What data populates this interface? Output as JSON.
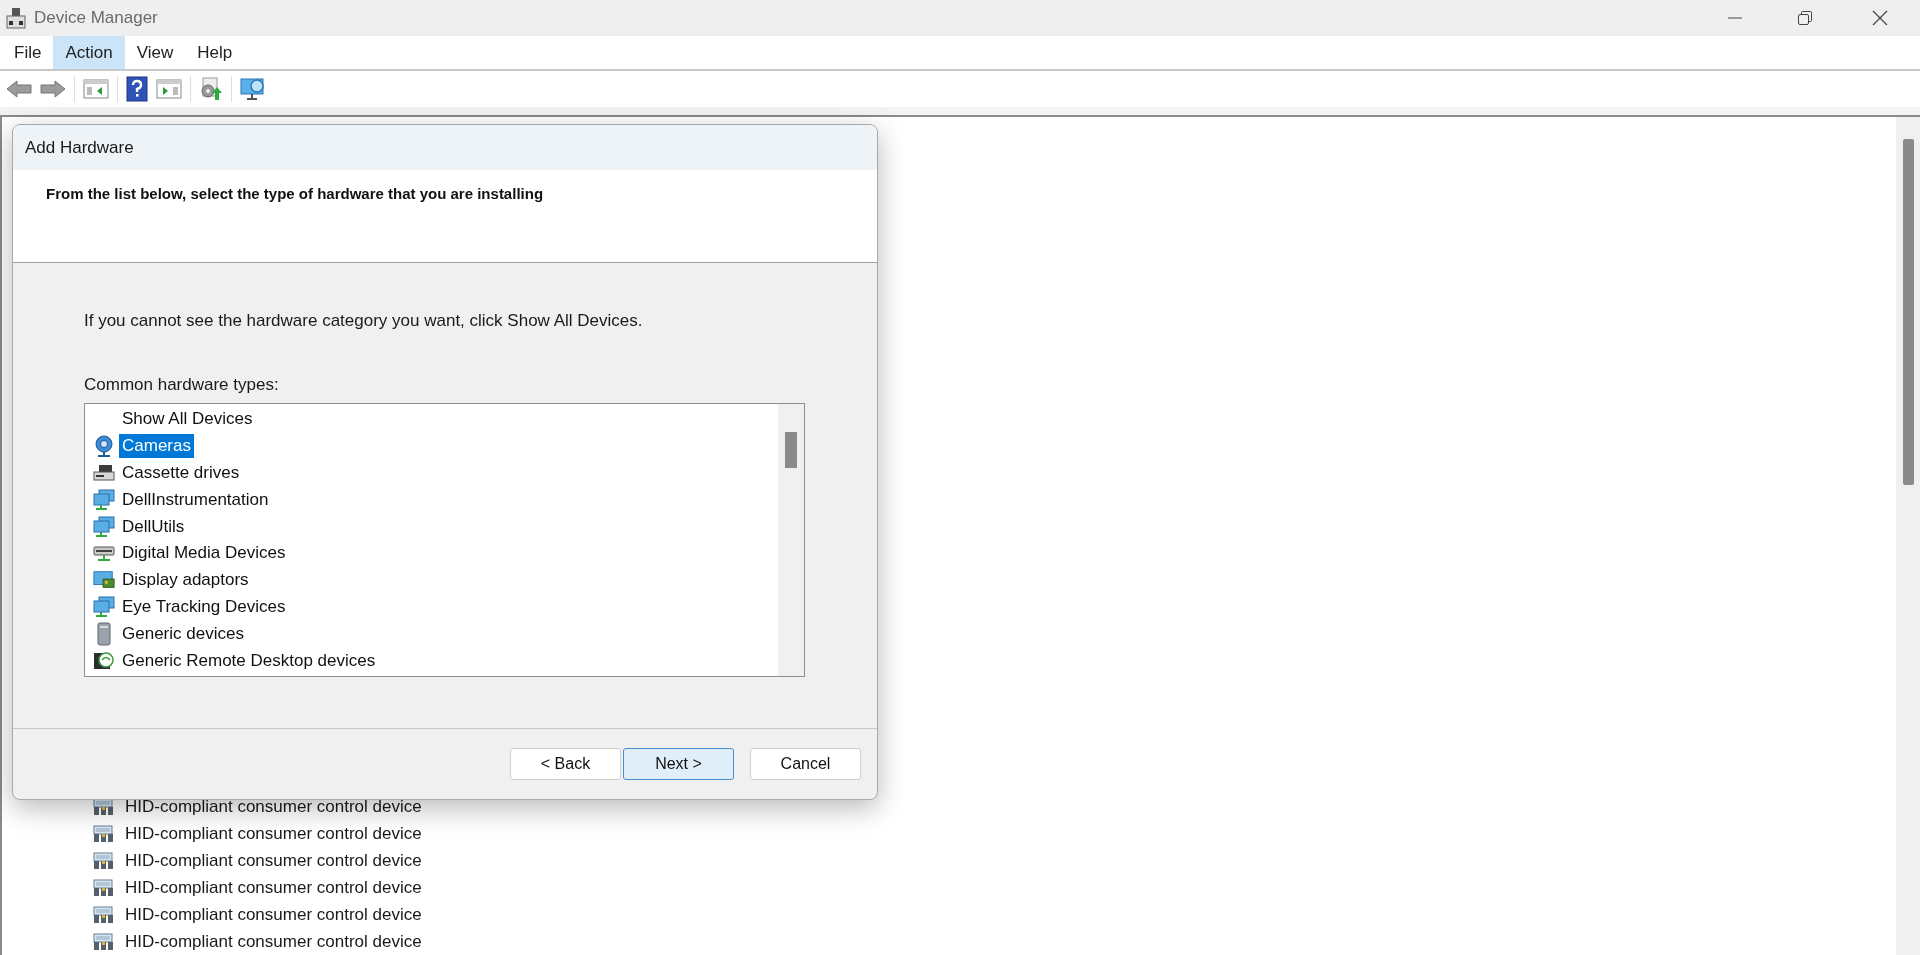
{
  "window": {
    "title": "Device Manager"
  },
  "menu": [
    {
      "label": "File",
      "selected": false
    },
    {
      "label": "Action",
      "selected": true
    },
    {
      "label": "View",
      "selected": false
    },
    {
      "label": "Help",
      "selected": false
    }
  ],
  "devices": [
    {
      "name": "HID-compliant consumer control device"
    },
    {
      "name": "HID-compliant consumer control device"
    },
    {
      "name": "HID-compliant consumer control device"
    },
    {
      "name": "HID-compliant consumer control device"
    },
    {
      "name": "HID-compliant consumer control device"
    },
    {
      "name": "HID-compliant consumer control device"
    }
  ],
  "dialog": {
    "title": "Add Hardware",
    "heading": "From the list below, select the type of hardware that you are installing",
    "hint": "If you cannot see the hardware category you want, click Show All Devices.",
    "list_label": "Common hardware types:",
    "hardware_types": [
      {
        "label": "Show All Devices",
        "kind": "plain",
        "selected": false
      },
      {
        "label": "Cameras",
        "kind": "camera",
        "selected": true
      },
      {
        "label": "Cassette drives",
        "kind": "cassette",
        "selected": false
      },
      {
        "label": "DellInstrumentation",
        "kind": "network",
        "selected": false
      },
      {
        "label": "DellUtils",
        "kind": "network",
        "selected": false
      },
      {
        "label": "Digital Media Devices",
        "kind": "media",
        "selected": false
      },
      {
        "label": "Display adaptors",
        "kind": "display",
        "selected": false
      },
      {
        "label": "Eye Tracking Devices",
        "kind": "network",
        "selected": false
      },
      {
        "label": "Generic devices",
        "kind": "generic",
        "selected": false
      },
      {
        "label": "Generic Remote Desktop devices",
        "kind": "remote",
        "selected": false
      }
    ],
    "buttons": [
      {
        "label": "< Back",
        "default": false
      },
      {
        "label": "Next >",
        "default": true
      },
      {
        "label": "Cancel",
        "default": false
      }
    ]
  }
}
